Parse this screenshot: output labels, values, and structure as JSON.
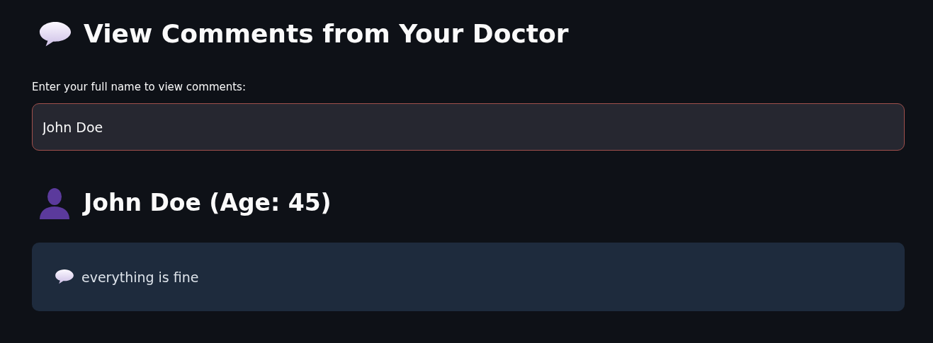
{
  "title": "View Comments from Your Doctor",
  "name_field": {
    "label": "Enter your full name to view comments:",
    "value": "John Doe",
    "focused": true
  },
  "patient": {
    "heading": "John Doe (Age: 45)"
  },
  "comments": [
    {
      "text": "everything is fine"
    }
  ]
}
